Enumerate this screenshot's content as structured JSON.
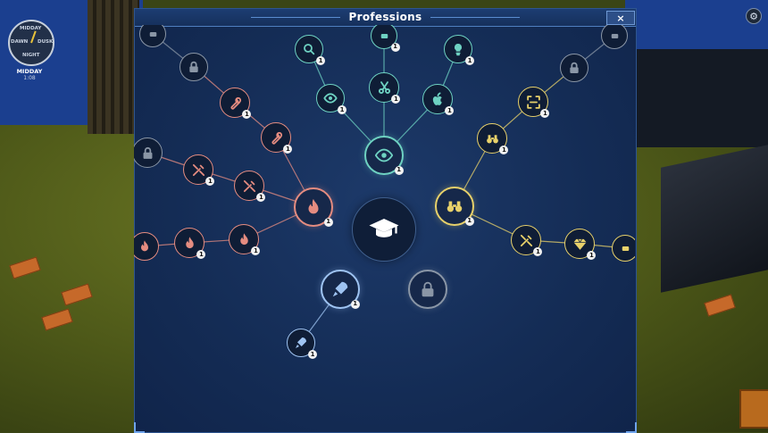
{
  "hud": {
    "clock_top": "MIDDAY",
    "clock_left": "DAWN",
    "clock_right": "DUSK",
    "clock_bottom": "NIGHT",
    "time_label": "MIDDAY",
    "time_value": "1:08"
  },
  "panel": {
    "title": "Professions",
    "close_label": "×"
  },
  "colors": {
    "red": "#e58c80",
    "teal": "#6ed2c2",
    "yellow": "#e8d16a",
    "blue": "#9fc4f2",
    "gray": "#8a96a6",
    "white": "#ffffff"
  },
  "tree": {
    "center": {
      "id": "center",
      "icon": "graduation-cap-icon",
      "theme": "white"
    },
    "nodes": [
      {
        "id": "top-left-cut",
        "icon": "unknown-icon",
        "theme": "gray",
        "level": ""
      },
      {
        "id": "lock-a",
        "icon": "lock-icon",
        "theme": "gray",
        "level": ""
      },
      {
        "id": "wrench-a",
        "icon": "wrench-icon",
        "theme": "red",
        "level": "1"
      },
      {
        "id": "wrench-b",
        "icon": "wrench-icon",
        "theme": "red",
        "level": "1"
      },
      {
        "id": "lock-left-cut",
        "icon": "lock-icon",
        "theme": "gray",
        "level": ""
      },
      {
        "id": "tools-a",
        "icon": "screwdriver-wrench-icon",
        "theme": "red",
        "level": "1"
      },
      {
        "id": "tools-b",
        "icon": "screwdriver-wrench-icon",
        "theme": "red",
        "level": "1"
      },
      {
        "id": "fire-main",
        "icon": "fire-icon",
        "theme": "red",
        "level": "1"
      },
      {
        "id": "fire-a",
        "icon": "fire-icon",
        "theme": "red",
        "level": "1"
      },
      {
        "id": "fire-b",
        "icon": "fire-icon",
        "theme": "red",
        "level": "1"
      },
      {
        "id": "fire-left-cut",
        "icon": "fire-icon",
        "theme": "red",
        "level": ""
      },
      {
        "id": "search",
        "icon": "magnifier-icon",
        "theme": "teal",
        "level": "1"
      },
      {
        "id": "top-mid-cut",
        "icon": "unknown-icon",
        "theme": "teal",
        "level": "1"
      },
      {
        "id": "eye-small",
        "icon": "eye-icon",
        "theme": "teal",
        "level": "1"
      },
      {
        "id": "scissors",
        "icon": "scissors-icon",
        "theme": "teal",
        "level": "1"
      },
      {
        "id": "bulb",
        "icon": "lightbulb-icon",
        "theme": "teal",
        "level": "1"
      },
      {
        "id": "apple",
        "icon": "apple-icon",
        "theme": "teal",
        "level": "1"
      },
      {
        "id": "eye-main",
        "icon": "eye-icon",
        "theme": "teal",
        "level": "1"
      },
      {
        "id": "top-right-cut",
        "icon": "unknown-icon",
        "theme": "gray",
        "level": ""
      },
      {
        "id": "lock-b",
        "icon": "lock-icon",
        "theme": "gray",
        "level": ""
      },
      {
        "id": "scan",
        "icon": "scan-icon",
        "theme": "yellow",
        "level": "1"
      },
      {
        "id": "binoculars-small",
        "icon": "binoculars-icon",
        "theme": "yellow",
        "level": "1"
      },
      {
        "id": "binoculars-main",
        "icon": "binoculars-icon",
        "theme": "yellow",
        "level": "1"
      },
      {
        "id": "tools-yellow",
        "icon": "screwdriver-wrench-icon",
        "theme": "yellow",
        "level": "1"
      },
      {
        "id": "gem",
        "icon": "gem-icon",
        "theme": "yellow",
        "level": "1"
      },
      {
        "id": "right-cut",
        "icon": "unknown-icon",
        "theme": "yellow",
        "level": ""
      },
      {
        "id": "rocket-main",
        "icon": "rocket-icon",
        "theme": "blue",
        "level": "1"
      },
      {
        "id": "rocket-small",
        "icon": "rocket-icon",
        "theme": "blue",
        "level": "1"
      },
      {
        "id": "lock-center",
        "icon": "lock-icon",
        "theme": "gray",
        "level": ""
      }
    ]
  }
}
